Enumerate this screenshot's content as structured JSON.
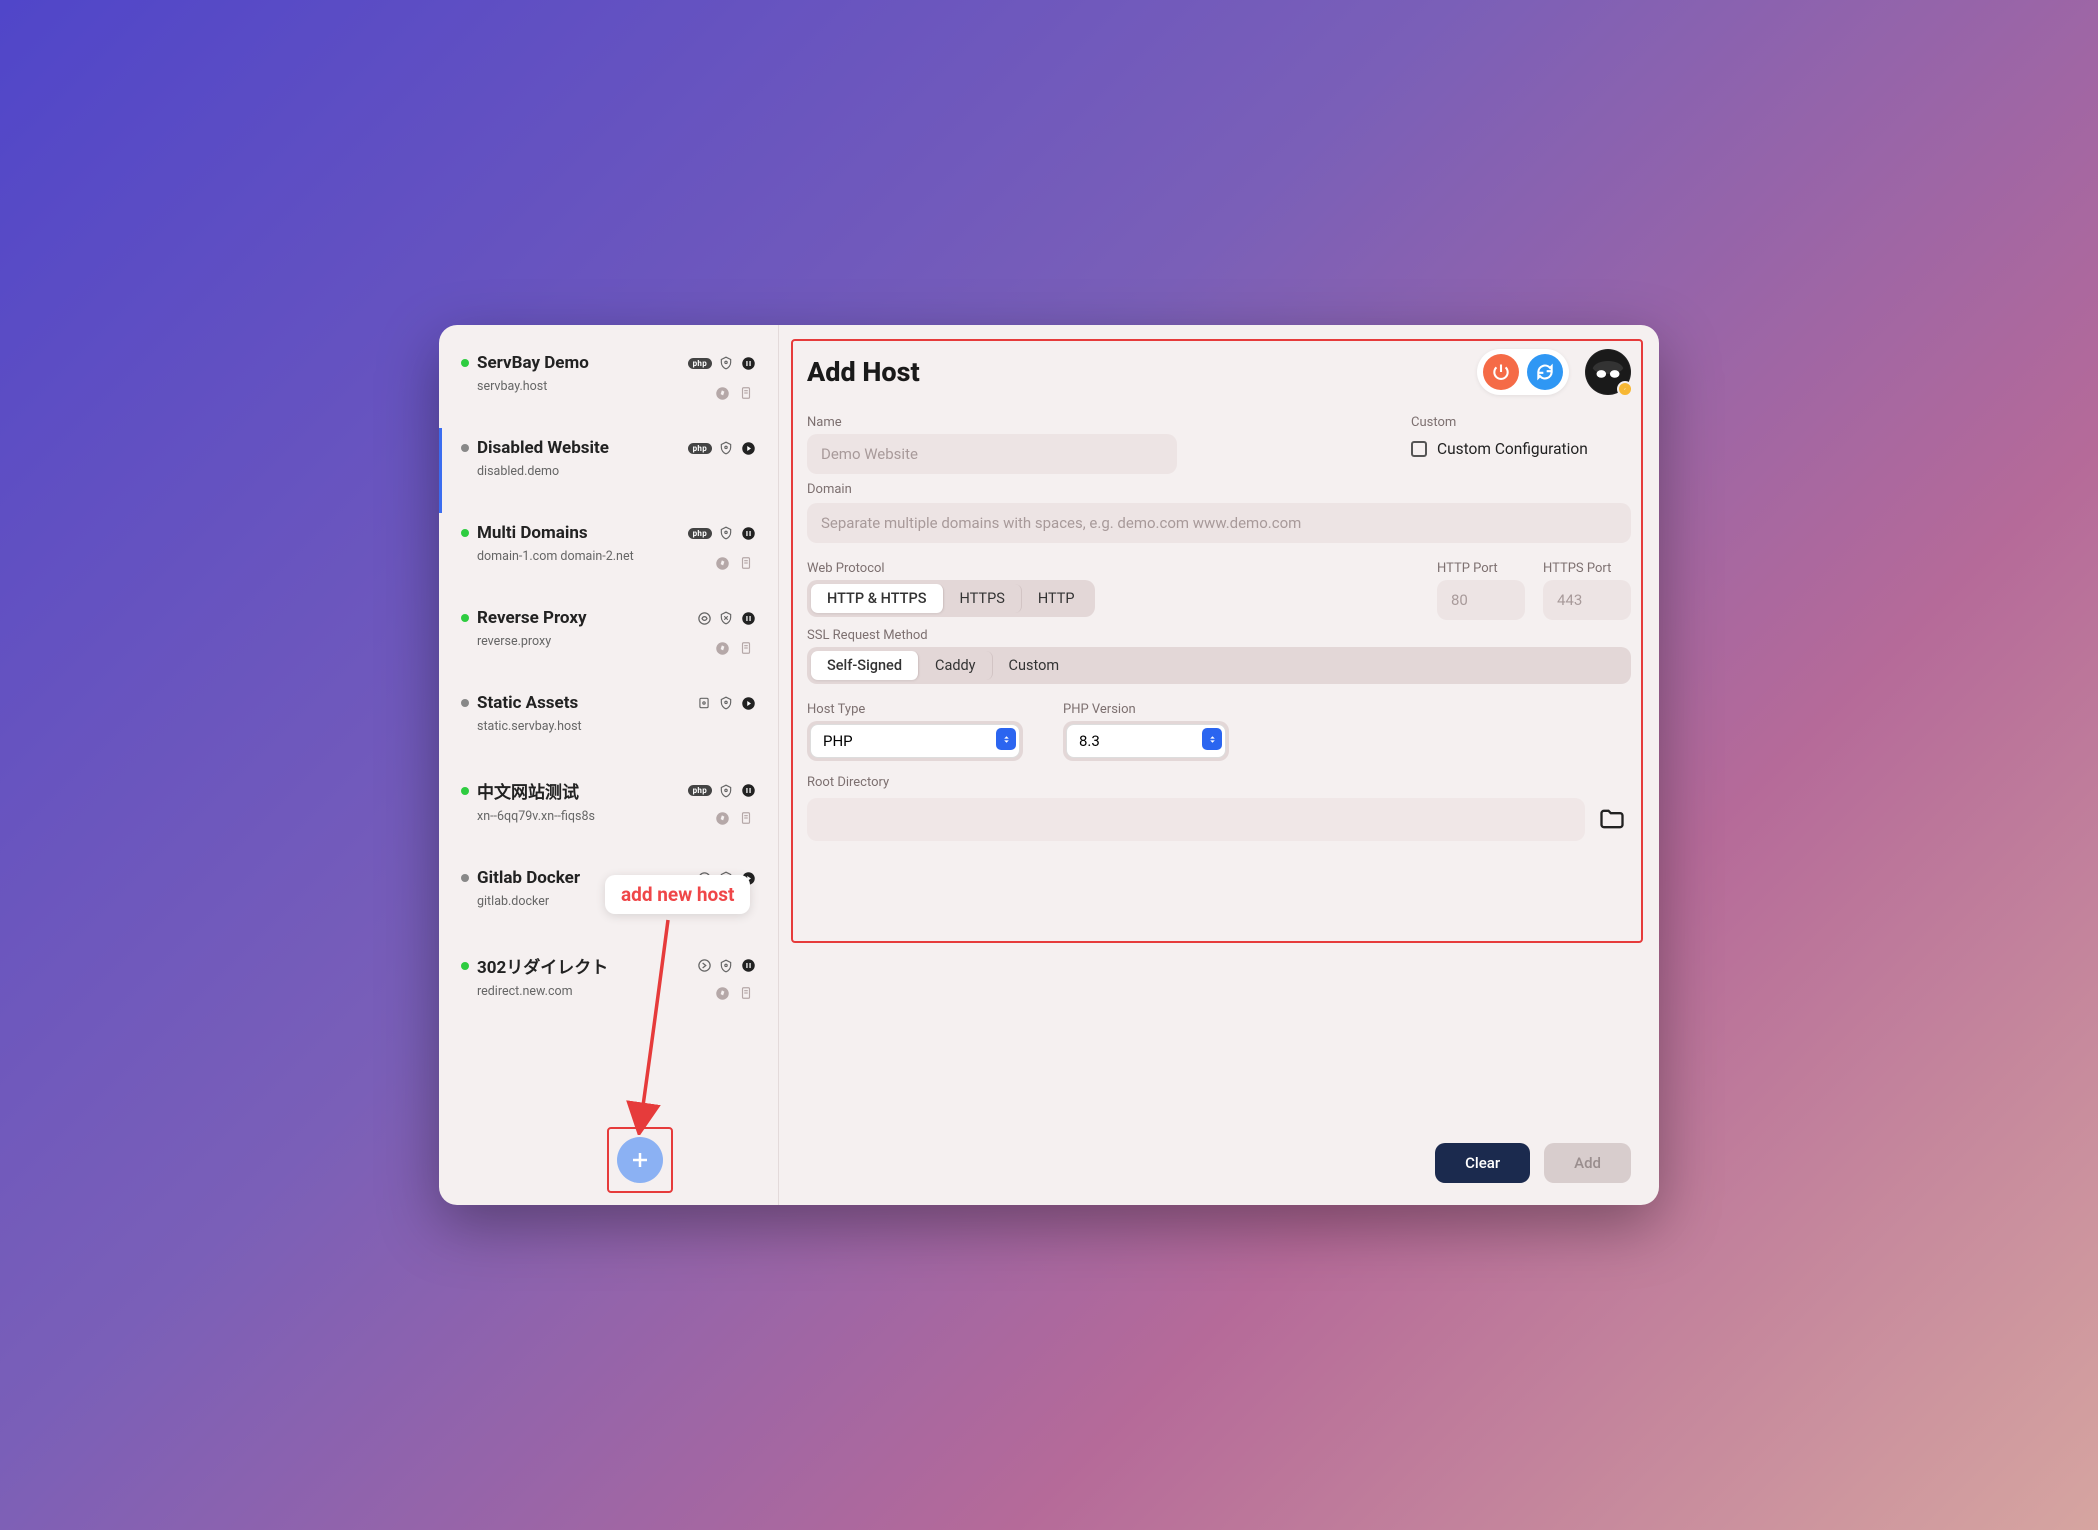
{
  "sidebar": {
    "items": [
      {
        "name": "ServBay Demo",
        "sub": "servbay.host",
        "status": "green",
        "type": "php",
        "state": "pause"
      },
      {
        "name": "Disabled Website",
        "sub": "disabled.demo",
        "status": "gray",
        "type": "php",
        "state": "play"
      },
      {
        "name": "Multi Domains",
        "sub": "domain-1.com domain-2.net",
        "status": "green",
        "type": "php",
        "state": "pause"
      },
      {
        "name": "Reverse Proxy",
        "sub": "reverse.proxy",
        "status": "green",
        "type": "proxy",
        "state": "pause"
      },
      {
        "name": "Static Assets",
        "sub": "static.servbay.host",
        "status": "gray",
        "type": "static",
        "state": "play"
      },
      {
        "name": "中文网站测试",
        "sub": "xn--6qq79v.xn--fiqs8s",
        "status": "green",
        "type": "php",
        "state": "pause"
      },
      {
        "name": "Gitlab Docker",
        "sub": "gitlab.docker",
        "status": "gray",
        "type": "proxy",
        "state": "play"
      },
      {
        "name": "302リダイレクト",
        "sub": "redirect.new.com",
        "status": "green",
        "type": "redirect",
        "state": "pause"
      }
    ]
  },
  "tooltip": "add new host",
  "form": {
    "title": "Add Host",
    "name_label": "Name",
    "name_placeholder": "Demo Website",
    "domain_label": "Domain",
    "domain_placeholder": "Separate multiple domains with spaces, e.g. demo.com www.demo.com",
    "protocol_label": "Web Protocol",
    "protocol_options": [
      "HTTP & HTTPS",
      "HTTPS",
      "HTTP"
    ],
    "protocol_selected": "HTTP & HTTPS",
    "http_port_label": "HTTP Port",
    "http_port_placeholder": "80",
    "https_port_label": "HTTPS Port",
    "https_port_placeholder": "443",
    "ssl_label": "SSL Request Method",
    "ssl_options": [
      "Self-Signed",
      "Caddy",
      "Custom"
    ],
    "ssl_selected": "Self-Signed",
    "host_type_label": "Host Type",
    "host_type_value": "PHP",
    "php_version_label": "PHP Version",
    "php_version_value": "8.3",
    "root_label": "Root Directory",
    "custom_label": "Custom",
    "custom_checkbox": "Custom Configuration"
  },
  "footer": {
    "clear": "Clear",
    "add": "Add"
  },
  "icons": {
    "php_badge": "php"
  }
}
